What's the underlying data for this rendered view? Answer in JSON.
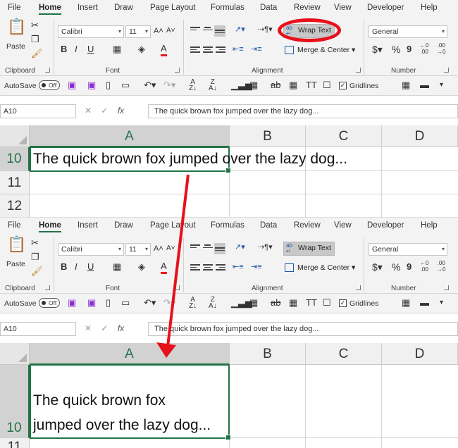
{
  "ribbon": {
    "tabs": [
      "File",
      "Home",
      "Insert",
      "Draw",
      "Page Layout",
      "Formulas",
      "Data",
      "Review",
      "View",
      "Developer",
      "Help"
    ],
    "active_tab": "Home",
    "clipboard": {
      "paste_label": "Paste",
      "group_label": "Clipboard"
    },
    "font": {
      "name": "Calibri",
      "size": "11",
      "group_label": "Font"
    },
    "alignment": {
      "wrap_text_label": "Wrap Text",
      "merge_label": "Merge & Center",
      "group_label": "Alignment"
    },
    "number": {
      "format": "General",
      "group_label": "Number"
    }
  },
  "quick_access": {
    "autosave_label": "AutoSave",
    "autosave_state": "Off",
    "gridlines_label": "Gridlines"
  },
  "formula_bar": {
    "name_box": "A10",
    "formula": "The quick brown fox jumped over the lazy dog..."
  },
  "sheet": {
    "columns": [
      "A",
      "B",
      "C",
      "D"
    ],
    "top_rows": [
      "10",
      "11",
      "12"
    ],
    "bottom_rows": [
      "10",
      "11"
    ],
    "cell_text_single": "The quick brown fox jumped over the lazy dog...",
    "cell_text_wrapped_line1": "The quick brown fox",
    "cell_text_wrapped_line2": "jumped over the lazy dog..."
  },
  "annotation": {
    "circle_color": "#e8101a",
    "arrow_color": "#e8101a"
  },
  "colors": {
    "excel_green": "#217346",
    "ribbon_bg": "#f3f3f3"
  }
}
